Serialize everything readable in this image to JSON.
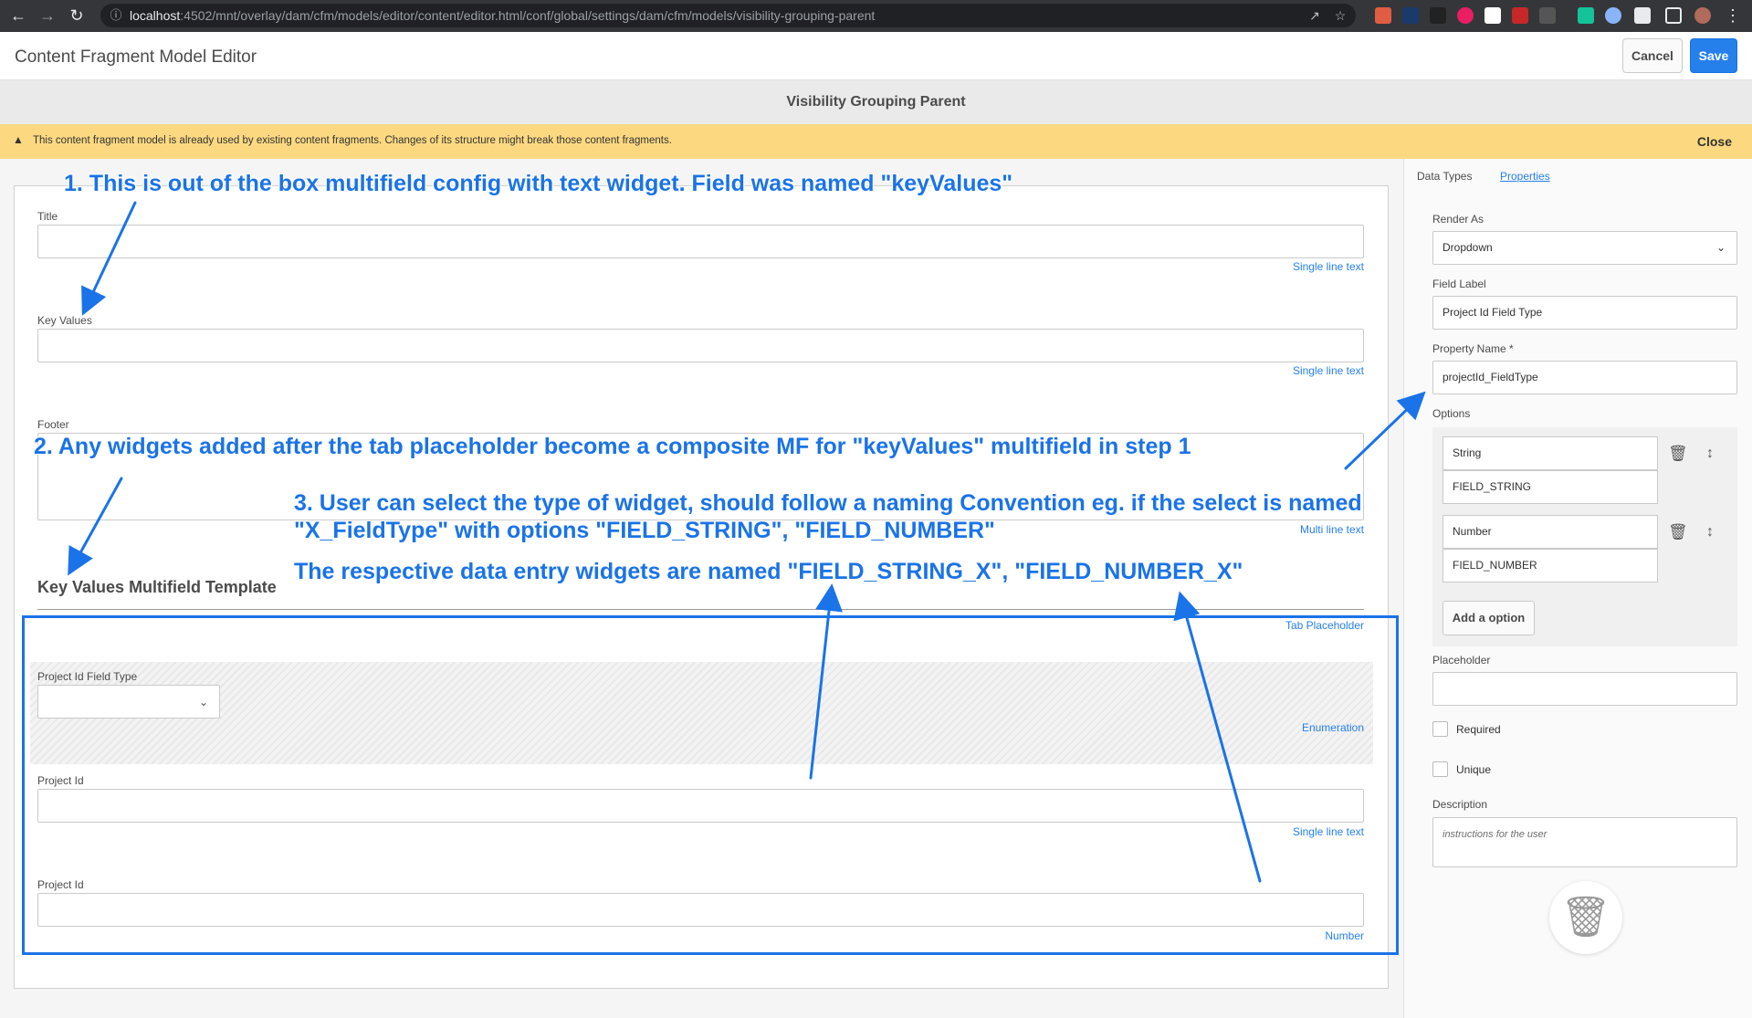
{
  "browser": {
    "url_host": "localhost",
    "url_rest": ":4502/mnt/overlay/dam/cfm/models/editor/content/editor.html/conf/global/settings/dam/cfm/models/visibility-grouping-parent"
  },
  "app": {
    "title": "Content Fragment Model Editor",
    "cancel_label": "Cancel",
    "save_label": "Save",
    "model_title": "Visibility Grouping Parent"
  },
  "warning": {
    "text": "This content fragment model is already used by existing content fragments. Changes of its structure might break those content fragments.",
    "close_label": "Close"
  },
  "canvas": {
    "fields": [
      {
        "label": "Title",
        "type": "Single line text"
      },
      {
        "label": "Key Values",
        "type": "Single line text"
      },
      {
        "label": "Footer",
        "type": "Multi line text"
      }
    ],
    "section_title": "Key Values Multifield Template",
    "tab_placeholder": "Tab Placeholder",
    "enum_field": {
      "label": "Project Id Field Type",
      "type": "Enumeration"
    },
    "project_id_1": {
      "label": "Project Id",
      "type": "Single line text"
    },
    "project_id_2": {
      "label": "Project Id",
      "type": "Number"
    }
  },
  "panel": {
    "tabs": [
      "Data Types",
      "Properties"
    ],
    "render_as_label": "Render As",
    "render_as_value": "Dropdown",
    "field_label_label": "Field Label",
    "field_label_value": "Project Id Field Type",
    "property_name_label": "Property Name *",
    "property_name_value": "projectId_FieldType",
    "options_label": "Options",
    "options": [
      {
        "label": "String",
        "value": "FIELD_STRING"
      },
      {
        "label": "Number",
        "value": "FIELD_NUMBER"
      }
    ],
    "add_option_label": "Add a option",
    "placeholder_label": "Placeholder",
    "required_label": "Required",
    "unique_label": "Unique",
    "description_label": "Description",
    "description_placeholder": "instructions for the user"
  },
  "annotations": {
    "note1": "1. This is out of the box multifield config with text widget. Field was named \"keyValues\"",
    "note2": "2. Any widgets added after the tab placeholder become a composite MF for \"keyValues\" multifield in step 1",
    "note3_line1": "3. User can select the type of widget, should follow a naming Convention eg. if the select is named",
    "note3_line2": "\"X_FieldType\" with  options \"FIELD_STRING\", \"FIELD_NUMBER\"",
    "note3_line3": "The respective data entry widgets are named \"FIELD_STRING_X\", \"FIELD_NUMBER_X\""
  },
  "colors": {
    "accent": "#2680eb",
    "annotation": "#1a73e8",
    "warning_bg": "#fcd981"
  }
}
